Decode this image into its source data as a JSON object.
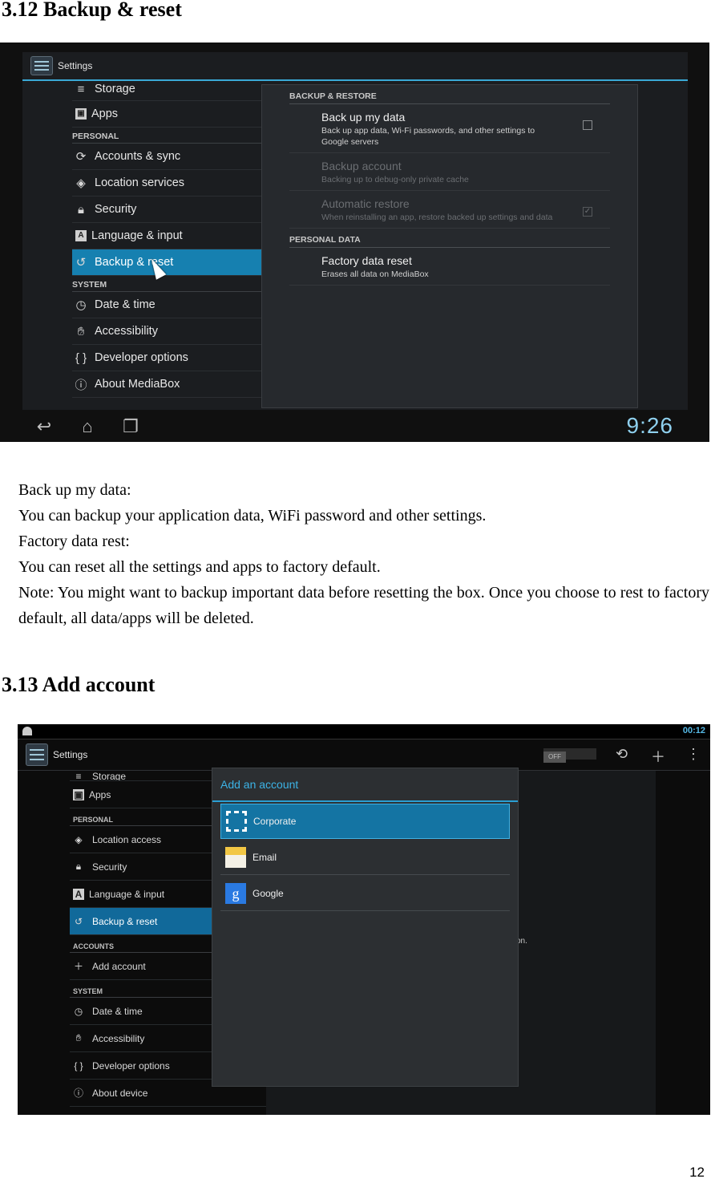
{
  "section_backup": {
    "heading": "3.12 Backup & reset",
    "screenshot": {
      "app_title": "Settings",
      "menu": {
        "top_cut": "Storage",
        "apps": "Apps",
        "cat_personal": "PERSONAL",
        "accounts": "Accounts & sync",
        "location": "Location services",
        "security": "Security",
        "language": "Language & input",
        "backup": "Backup & reset",
        "cat_system": "SYSTEM",
        "date": "Date & time",
        "accessibility": "Accessibility",
        "developer": "Developer options",
        "about": "About MediaBox"
      },
      "detail": {
        "cat_backup": "BACKUP & RESTORE",
        "backup_title": "Back up my data",
        "backup_sub": "Back up app data, Wi-Fi passwords, and other settings to Google servers",
        "account_title": "Backup account",
        "account_sub": "Backing up to debug-only private cache",
        "restore_title": "Automatic restore",
        "restore_sub": "When reinstalling an app, restore backed up settings and data",
        "cat_personal": "PERSONAL DATA",
        "factory_title": "Factory data reset",
        "factory_sub": "Erases all data on MediaBox"
      },
      "clock": "9:26"
    },
    "text": {
      "l1": "Back up my data:",
      "l2": "You can backup your application data, WiFi password and other settings.",
      "l3": "Factory data rest:",
      "l4": "You can reset all the settings and apps to factory default.",
      "l5": "Note: You might want to backup important data before resetting the box. Once you choose to rest to factory default, all data/apps will be deleted."
    }
  },
  "section_account": {
    "heading": "3.13 Add account",
    "screenshot": {
      "status_time": "00:12",
      "app_title": "Settings",
      "toggle_off": "OFF",
      "menu": {
        "top_cut": "Storage",
        "apps": "Apps",
        "cat_personal": "PERSONAL",
        "location": "Location access",
        "security": "Security",
        "language": "Language & input",
        "backup": "Backup & reset",
        "cat_accounts": "ACCOUNTS",
        "add_account": "Add account",
        "cat_system": "SYSTEM",
        "date": "Date & time",
        "accessibility": "Accessibility",
        "developer": "Developer options",
        "about": "About device"
      },
      "fragment": "on.",
      "dialog": {
        "title": "Add an account",
        "corporate": "Corporate",
        "email": "Email",
        "google": "Google"
      }
    }
  },
  "page_number": "12"
}
